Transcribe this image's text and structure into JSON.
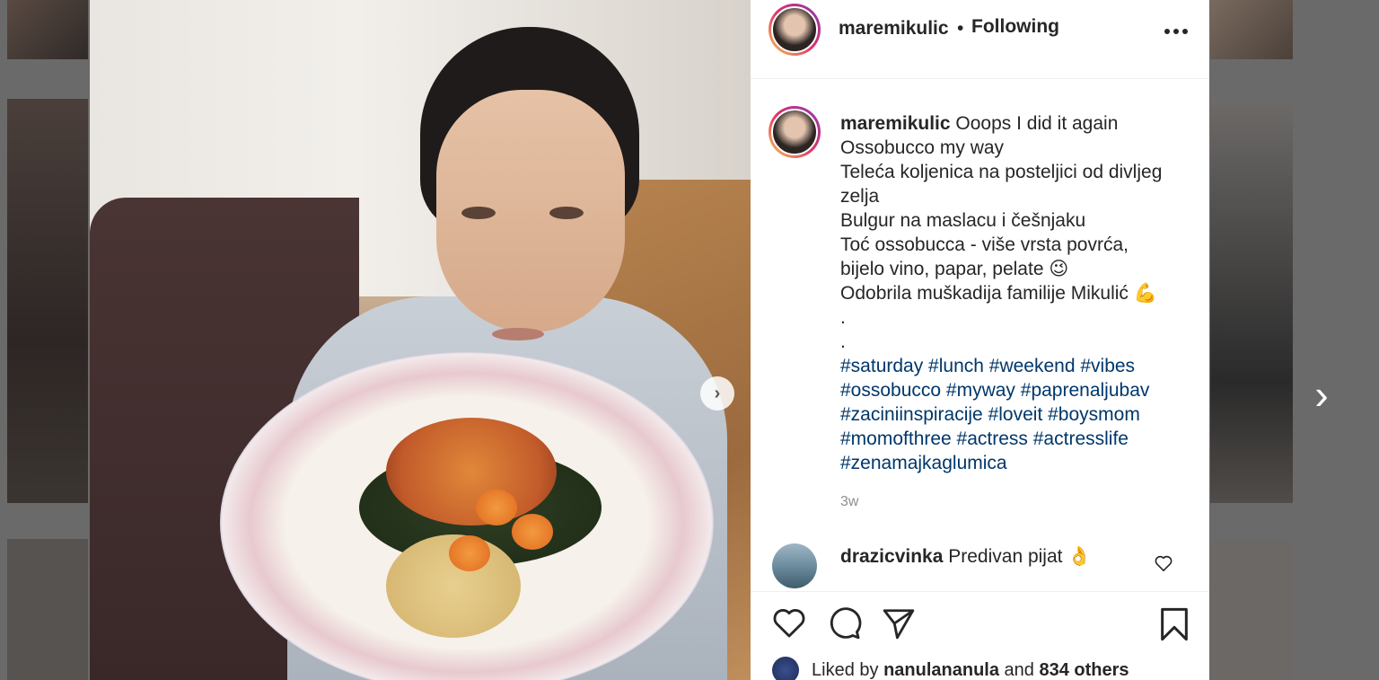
{
  "post": {
    "username": "maremikulic",
    "separator": "•",
    "follow_status": "Following",
    "more_label": "•••",
    "caption_lines": [
      "Ooops I did it again",
      "Ossobucco my way",
      "Teleća koljenica na posteljici od divljeg",
      "zelja",
      "Bulgur na maslacu i češnjaku",
      "Toć ossobucca - više vrsta povrća,",
      "bijelo vino, papar, pelate 😉",
      "Odobrila muškadija familije Mikulić 💪",
      ".",
      "."
    ],
    "hashtag_lines": [
      "#saturday #lunch #weekend #vibes",
      "#ossobucco #myway #paprenaljubav",
      "#zaciniinspiracije #loveit #boysmom",
      "#momofthree #actress #actresslife",
      "#zenamajkaglumica"
    ],
    "time_ago": "3w"
  },
  "comment": {
    "username": "drazicvinka",
    "text": "Predivan pijat 👌",
    "like_icon": "heart-icon"
  },
  "actions": {
    "like_icon": "heart-icon",
    "comment_icon": "comment-bubble-icon",
    "share_icon": "paper-plane-icon",
    "save_icon": "bookmark-icon"
  },
  "likes": {
    "prefix": "Liked by",
    "user": "nanulananula",
    "and": "and",
    "others": "834 others"
  },
  "navigation": {
    "photo_next_icon": "chevron-right-icon",
    "modal_next_icon": "chevron-right-icon"
  }
}
